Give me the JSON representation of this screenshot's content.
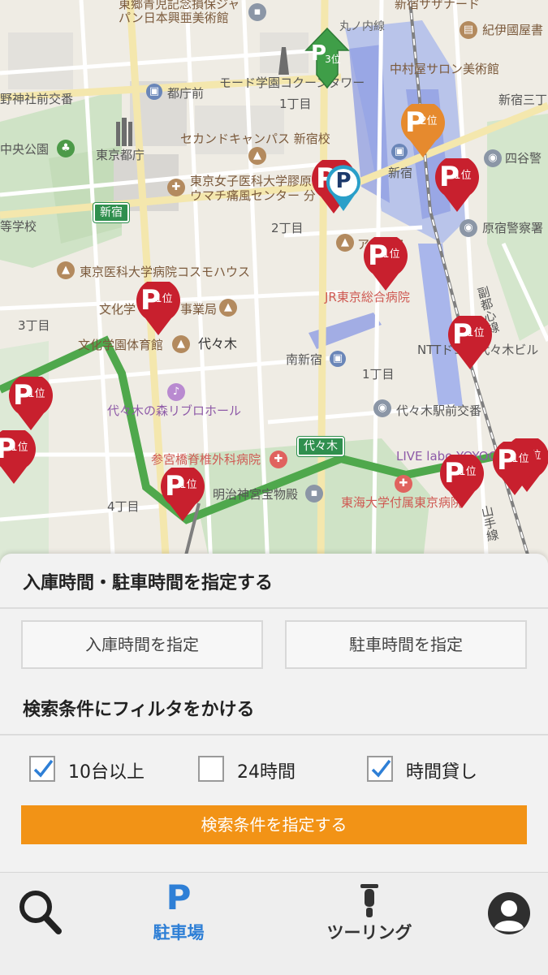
{
  "map": {
    "labels": {
      "aoyama": "東郷青児記念損保ジャ",
      "museum": "パン日本興亜美術館",
      "saznaade": "新宿サザナード",
      "kinokuniya": "紀伊國屋書",
      "marunouchi": "丸ノ内線",
      "nakamuraya": "中村屋サロン美術館",
      "shinjuku3": "新宿三丁",
      "tochomae": "都庁前",
      "mode": "モード学園コクーンタワー",
      "chome1a": "1丁目",
      "yotsuya": "四谷警",
      "jinja": "野神社前交番",
      "chuo_park": "中央公園",
      "tocho": "東京都庁",
      "second_campus": "セカンドキャンパス 新宿校",
      "shinjuku_st": "新宿",
      "joshi": "東京女子医科大学膠原",
      "umachi": "ウマチ痛風センター 分",
      "harajuku_police": "原宿警察署",
      "shinjuku_sign": "新宿",
      "chome2": "2丁目",
      "gakko": "等学校",
      "ikadai": "東京医科大学病院コスモハウス",
      "axis": "アクシス",
      "jr_hospital": "JR東京総合病院",
      "bunka": "文化学",
      "jimukyoku": "事業局",
      "chome3": "3丁目",
      "bunka_gym": "文化学園体育館",
      "yoyogi": "代々木",
      "minami_shinjuku": "南新宿",
      "ntt": "NTTドコモ代々木ビル",
      "chome1b": "1丁目",
      "fukutoshin": "副都心線",
      "liblo": "代々木の森リブロホール",
      "yoyogi_koban": "代々木駅前交番",
      "sangubashi": "参宮橋脊椎外科病院",
      "yoyogi_sign": "代々木",
      "live": "LIVE labo YOYOGI",
      "chome4": "4丁目",
      "meiji": "明治神宮宝物殿",
      "tokai": "東海大学付属東京病院",
      "yamanote": "山手線"
    },
    "pins": [
      {
        "rank": "3位",
        "color": "#3f9e48",
        "shape": "arrow"
      },
      {
        "rank": "2位",
        "color": "#e68a2e",
        "shape": "balloon"
      },
      {
        "rank": "1位",
        "color": "#c8202e",
        "shape": "balloon"
      },
      {
        "rank": "1位",
        "color": "#c8202e",
        "shape": "balloon"
      },
      {
        "rank": "1位",
        "color": "#c8202e",
        "shape": "balloon"
      },
      {
        "rank": "1位",
        "color": "#c8202e",
        "shape": "balloon"
      },
      {
        "rank": "1位",
        "color": "#c8202e",
        "shape": "balloon"
      },
      {
        "rank": "1位",
        "color": "#c8202e",
        "shape": "balloon"
      },
      {
        "rank": "1位",
        "color": "#c8202e",
        "shape": "balloon"
      },
      {
        "rank": "1位",
        "color": "#c8202e",
        "shape": "balloon"
      },
      {
        "rank": "1位",
        "color": "#c8202e",
        "shape": "balloon"
      },
      {
        "rank": "1位",
        "color": "#c8202e",
        "shape": "balloon"
      },
      {
        "rank": "1位",
        "color": "#c8202e",
        "shape": "balloon"
      }
    ],
    "current_marker": "P",
    "current_marker_color": "#2a9fc9"
  },
  "sheet": {
    "time_title": "入庫時間・駐車時間を指定する",
    "entry_time_button": "入庫時間を指定",
    "parking_time_button": "駐車時間を指定",
    "filter_title": "検索条件にフィルタをかける",
    "filters": [
      {
        "label": "10台以上",
        "checked": true
      },
      {
        "label": "24時間",
        "checked": false
      },
      {
        "label": "時間貸し",
        "checked": true
      }
    ],
    "search_button": "検索条件を指定する",
    "accent_color": "#f29316"
  },
  "tabbar": {
    "search_icon": "search-icon",
    "parking_icon_text": "P",
    "parking_label": "駐車場",
    "touring_icon": "motorcycle-icon",
    "touring_label": "ツーリング",
    "account_icon": "user-icon",
    "active_color": "#2e7fd6"
  }
}
